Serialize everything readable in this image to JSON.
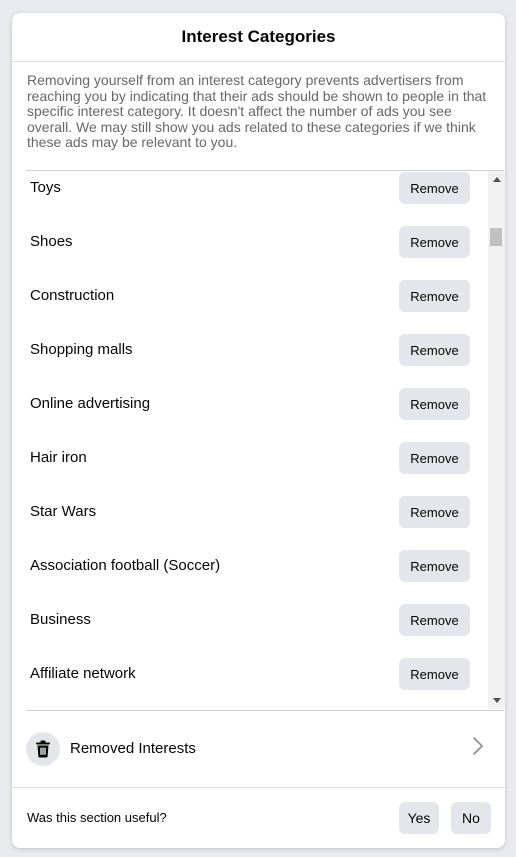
{
  "dialog": {
    "title": "Interest Categories",
    "description": "Removing yourself from an interest category prevents advertisers from reaching you by indicating that their ads should be shown to people in that specific interest category. It doesn't affect the number of ads you see overall. We may still show you ads related to these categories if we think these ads may be relevant to you."
  },
  "interests": {
    "remove_label": "Remove",
    "items": [
      {
        "label": "Toys"
      },
      {
        "label": "Shoes"
      },
      {
        "label": "Construction"
      },
      {
        "label": "Shopping malls"
      },
      {
        "label": "Online advertising"
      },
      {
        "label": "Hair iron"
      },
      {
        "label": "Star Wars"
      },
      {
        "label": "Association football (Soccer)"
      },
      {
        "label": "Business"
      },
      {
        "label": "Affiliate network"
      }
    ]
  },
  "removed": {
    "label": "Removed Interests",
    "icon": "trash-icon"
  },
  "footer": {
    "question": "Was this section useful?",
    "yes_label": "Yes",
    "no_label": "No"
  }
}
